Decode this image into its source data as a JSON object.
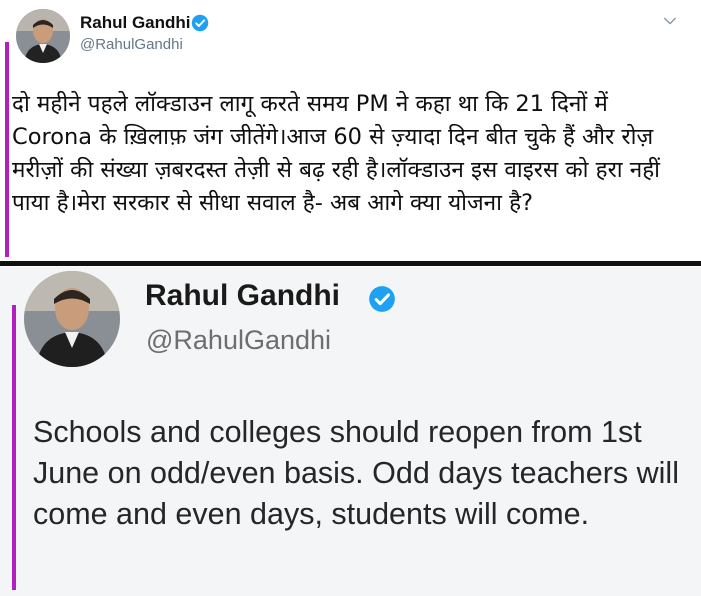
{
  "top_tweet": {
    "author": {
      "name": "Rahul Gandhi",
      "handle": "@RahulGandhi",
      "verified_icon": "verified-badge-icon"
    },
    "menu_icon": "chevron-down-icon",
    "text": "दो महीने पहले लॉक्डाउन लागू करते समय PM ने कहा था कि 21 दिनों में Corona के ख़िलाफ़ जंग जीतेंगे।आज 60 से ज़्यादा दिन बीत चुके हैं और रोज़ मरीज़ों की संख्या ज़बरदस्त तेज़ी से बढ़ रही है।लॉक्डाउन इस वाइरस को हरा नहीं पाया है।मेरा सरकार से सीधा सवाल है- अब आगे क्या योजना है?"
  },
  "bottom_tweet": {
    "author": {
      "name": "Rahul Gandhi",
      "handle": "@RahulGandhi",
      "verified_icon": "verified-badge-icon"
    },
    "text": "Schools and colleges should reopen from 1st June on odd/even basis. Odd days teachers will come and even days, students will come."
  },
  "colors": {
    "accent_bar": "#b21fbf",
    "verified_blue": "#1da1f2",
    "handle_gray": "#657786",
    "divider": "#111111"
  }
}
